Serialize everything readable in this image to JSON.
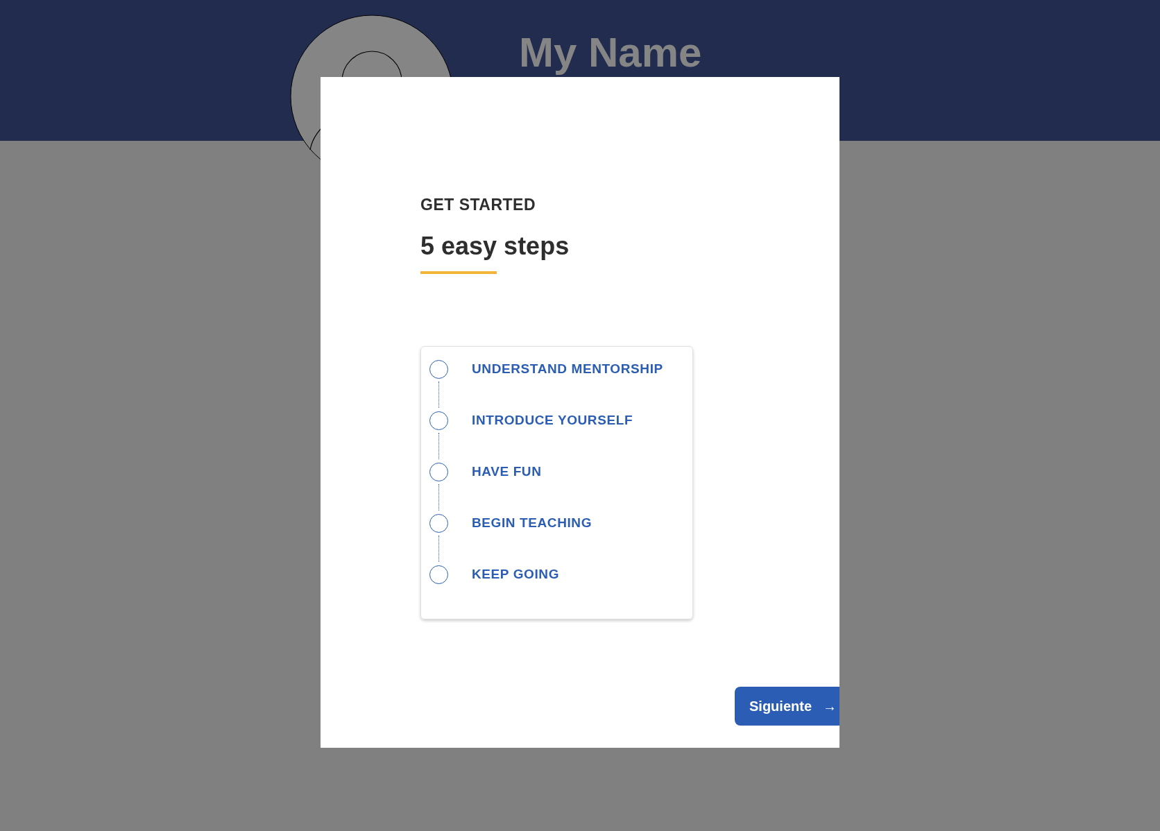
{
  "header": {
    "name": "My Name"
  },
  "modal": {
    "eyebrow": "GET STARTED",
    "title": "5 easy steps",
    "steps": [
      {
        "label": "UNDERSTAND MENTORSHIP",
        "done": false
      },
      {
        "label": "INTRODUCE YOURSELF",
        "done": false
      },
      {
        "label": "HAVE FUN",
        "done": false
      },
      {
        "label": "BEGIN TEACHING",
        "done": false
      },
      {
        "label": "KEEP GOING",
        "done": false
      }
    ],
    "next_button": {
      "label": "Siguiente",
      "icon": "→"
    }
  }
}
